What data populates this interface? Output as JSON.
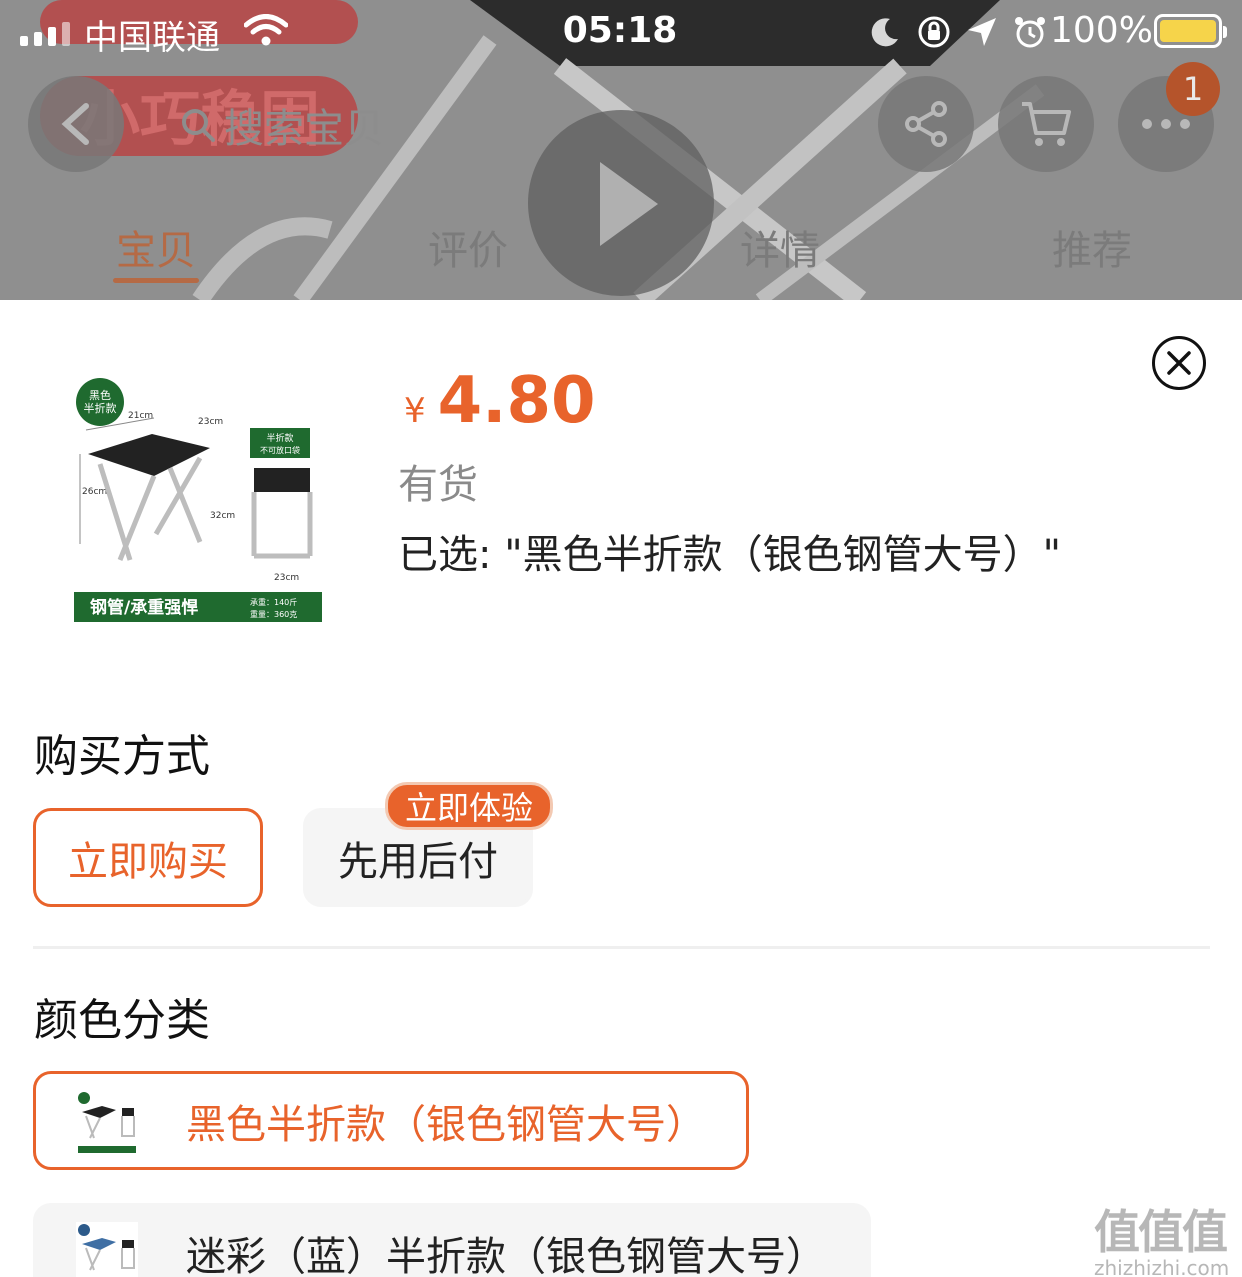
{
  "status_bar": {
    "carrier": "中国联通",
    "time": "05:18",
    "battery": "100%"
  },
  "header": {
    "search_placeholder": "搜索宝贝",
    "cart_count": "1",
    "icons": [
      "back-icon",
      "search-icon",
      "share-icon",
      "cart-icon",
      "more-icon",
      "play-icon"
    ]
  },
  "tabs": [
    {
      "label": "宝贝",
      "active": true
    },
    {
      "label": "评价",
      "active": false
    },
    {
      "label": "详情",
      "active": false
    },
    {
      "label": "推荐",
      "active": false
    }
  ],
  "product": {
    "currency": "¥",
    "price": "4.80",
    "stock": "有货",
    "selected": "已选: \"黑色半折款（银色钢管大号）\"",
    "image_text": {
      "badge": "黑色\n半折款",
      "dim_21": "21cm",
      "dim_23_top": "23cm",
      "dim_26": "26cm",
      "dim_32": "32cm",
      "dim_23_bottom": "23cm",
      "side_label_1": "半折款",
      "side_label_2": "不可放口袋",
      "banner_main": "钢管/承重强悍",
      "banner_spec_1": "承重：140斤",
      "banner_spec_2": "重量：360克"
    }
  },
  "purchase_method": {
    "title": "购买方式",
    "options": [
      {
        "label": "立即购买",
        "selected": true
      },
      {
        "label": "先用后付",
        "selected": false,
        "badge": "立即体验"
      }
    ]
  },
  "color_category": {
    "title": "颜色分类",
    "options": [
      {
        "label": "黑色半折款（银色钢管大号）",
        "selected": true
      },
      {
        "label": "迷彩（蓝）半折款（银色钢管大号）",
        "selected": false
      }
    ]
  },
  "watermark": {
    "big": "值值值",
    "small": "zhizhizhi.com"
  },
  "colors": {
    "accent": "#e8632b",
    "dim_overlay": "#8f8f8f",
    "banner_green": "#1f6a2f"
  }
}
